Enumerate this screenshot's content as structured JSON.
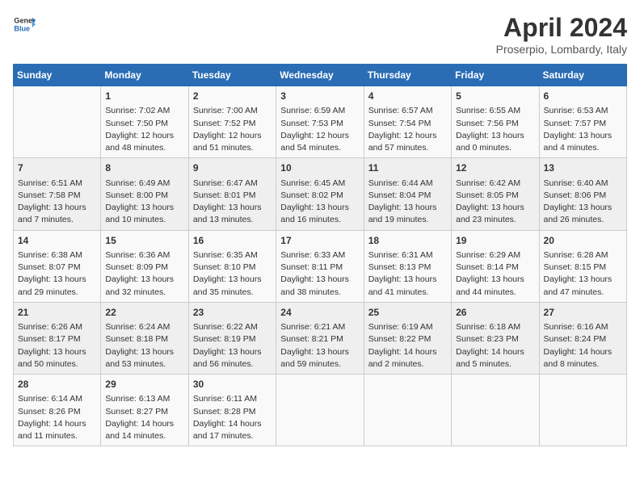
{
  "header": {
    "logo_general": "General",
    "logo_blue": "Blue",
    "title": "April 2024",
    "location": "Proserpio, Lombardy, Italy"
  },
  "weekdays": [
    "Sunday",
    "Monday",
    "Tuesday",
    "Wednesday",
    "Thursday",
    "Friday",
    "Saturday"
  ],
  "weeks": [
    [
      {
        "day": "",
        "info": ""
      },
      {
        "day": "1",
        "info": "Sunrise: 7:02 AM\nSunset: 7:50 PM\nDaylight: 12 hours\nand 48 minutes."
      },
      {
        "day": "2",
        "info": "Sunrise: 7:00 AM\nSunset: 7:52 PM\nDaylight: 12 hours\nand 51 minutes."
      },
      {
        "day": "3",
        "info": "Sunrise: 6:59 AM\nSunset: 7:53 PM\nDaylight: 12 hours\nand 54 minutes."
      },
      {
        "day": "4",
        "info": "Sunrise: 6:57 AM\nSunset: 7:54 PM\nDaylight: 12 hours\nand 57 minutes."
      },
      {
        "day": "5",
        "info": "Sunrise: 6:55 AM\nSunset: 7:56 PM\nDaylight: 13 hours\nand 0 minutes."
      },
      {
        "day": "6",
        "info": "Sunrise: 6:53 AM\nSunset: 7:57 PM\nDaylight: 13 hours\nand 4 minutes."
      }
    ],
    [
      {
        "day": "7",
        "info": "Sunrise: 6:51 AM\nSunset: 7:58 PM\nDaylight: 13 hours\nand 7 minutes."
      },
      {
        "day": "8",
        "info": "Sunrise: 6:49 AM\nSunset: 8:00 PM\nDaylight: 13 hours\nand 10 minutes."
      },
      {
        "day": "9",
        "info": "Sunrise: 6:47 AM\nSunset: 8:01 PM\nDaylight: 13 hours\nand 13 minutes."
      },
      {
        "day": "10",
        "info": "Sunrise: 6:45 AM\nSunset: 8:02 PM\nDaylight: 13 hours\nand 16 minutes."
      },
      {
        "day": "11",
        "info": "Sunrise: 6:44 AM\nSunset: 8:04 PM\nDaylight: 13 hours\nand 19 minutes."
      },
      {
        "day": "12",
        "info": "Sunrise: 6:42 AM\nSunset: 8:05 PM\nDaylight: 13 hours\nand 23 minutes."
      },
      {
        "day": "13",
        "info": "Sunrise: 6:40 AM\nSunset: 8:06 PM\nDaylight: 13 hours\nand 26 minutes."
      }
    ],
    [
      {
        "day": "14",
        "info": "Sunrise: 6:38 AM\nSunset: 8:07 PM\nDaylight: 13 hours\nand 29 minutes."
      },
      {
        "day": "15",
        "info": "Sunrise: 6:36 AM\nSunset: 8:09 PM\nDaylight: 13 hours\nand 32 minutes."
      },
      {
        "day": "16",
        "info": "Sunrise: 6:35 AM\nSunset: 8:10 PM\nDaylight: 13 hours\nand 35 minutes."
      },
      {
        "day": "17",
        "info": "Sunrise: 6:33 AM\nSunset: 8:11 PM\nDaylight: 13 hours\nand 38 minutes."
      },
      {
        "day": "18",
        "info": "Sunrise: 6:31 AM\nSunset: 8:13 PM\nDaylight: 13 hours\nand 41 minutes."
      },
      {
        "day": "19",
        "info": "Sunrise: 6:29 AM\nSunset: 8:14 PM\nDaylight: 13 hours\nand 44 minutes."
      },
      {
        "day": "20",
        "info": "Sunrise: 6:28 AM\nSunset: 8:15 PM\nDaylight: 13 hours\nand 47 minutes."
      }
    ],
    [
      {
        "day": "21",
        "info": "Sunrise: 6:26 AM\nSunset: 8:17 PM\nDaylight: 13 hours\nand 50 minutes."
      },
      {
        "day": "22",
        "info": "Sunrise: 6:24 AM\nSunset: 8:18 PM\nDaylight: 13 hours\nand 53 minutes."
      },
      {
        "day": "23",
        "info": "Sunrise: 6:22 AM\nSunset: 8:19 PM\nDaylight: 13 hours\nand 56 minutes."
      },
      {
        "day": "24",
        "info": "Sunrise: 6:21 AM\nSunset: 8:21 PM\nDaylight: 13 hours\nand 59 minutes."
      },
      {
        "day": "25",
        "info": "Sunrise: 6:19 AM\nSunset: 8:22 PM\nDaylight: 14 hours\nand 2 minutes."
      },
      {
        "day": "26",
        "info": "Sunrise: 6:18 AM\nSunset: 8:23 PM\nDaylight: 14 hours\nand 5 minutes."
      },
      {
        "day": "27",
        "info": "Sunrise: 6:16 AM\nSunset: 8:24 PM\nDaylight: 14 hours\nand 8 minutes."
      }
    ],
    [
      {
        "day": "28",
        "info": "Sunrise: 6:14 AM\nSunset: 8:26 PM\nDaylight: 14 hours\nand 11 minutes."
      },
      {
        "day": "29",
        "info": "Sunrise: 6:13 AM\nSunset: 8:27 PM\nDaylight: 14 hours\nand 14 minutes."
      },
      {
        "day": "30",
        "info": "Sunrise: 6:11 AM\nSunset: 8:28 PM\nDaylight: 14 hours\nand 17 minutes."
      },
      {
        "day": "",
        "info": ""
      },
      {
        "day": "",
        "info": ""
      },
      {
        "day": "",
        "info": ""
      },
      {
        "day": "",
        "info": ""
      }
    ]
  ]
}
